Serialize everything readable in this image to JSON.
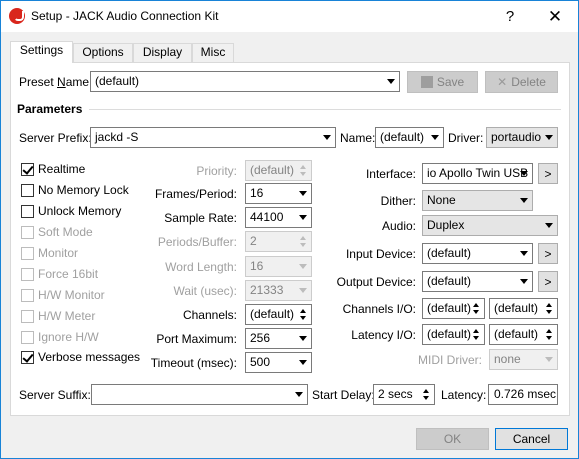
{
  "window": {
    "title": "Setup - JACK Audio Connection Kit",
    "help_glyph": "?",
    "close_glyph": "✕"
  },
  "tabs": [
    {
      "label": "Settings",
      "active": true
    },
    {
      "label": "Options",
      "active": false
    },
    {
      "label": "Display",
      "active": false
    },
    {
      "label": "Misc",
      "active": false
    }
  ],
  "preset": {
    "label_pre": "Preset ",
    "label_u": "N",
    "label_post": "ame:",
    "value": "(default)",
    "save": "Save",
    "delete": "Delete"
  },
  "parameters_title": "Parameters",
  "server_prefix": {
    "label": "Server Prefix:",
    "value": "jackd -S"
  },
  "name": {
    "label": "Name:",
    "value": "(default)"
  },
  "driver": {
    "label": "Driver:",
    "value": "portaudio"
  },
  "checkboxes": [
    {
      "label": "Realtime",
      "checked": true,
      "enabled": true
    },
    {
      "label": "No Memory Lock",
      "checked": false,
      "enabled": true
    },
    {
      "label": "Unlock Memory",
      "checked": false,
      "enabled": true
    },
    {
      "label": "Soft Mode",
      "checked": false,
      "enabled": false
    },
    {
      "label": "Monitor",
      "checked": false,
      "enabled": false
    },
    {
      "label": "Force 16bit",
      "checked": false,
      "enabled": false
    },
    {
      "label": "H/W Monitor",
      "checked": false,
      "enabled": false
    },
    {
      "label": "H/W Meter",
      "checked": false,
      "enabled": false
    },
    {
      "label": "Ignore H/W",
      "checked": false,
      "enabled": false
    },
    {
      "label": "Verbose messages",
      "checked": true,
      "enabled": true
    }
  ],
  "mid_fields": [
    {
      "label": "Priority:",
      "value": "(default)",
      "enabled": false
    },
    {
      "label": "Frames/Period:",
      "value": "16",
      "enabled": true
    },
    {
      "label": "Sample Rate:",
      "value": "44100",
      "enabled": true
    },
    {
      "label": "Periods/Buffer:",
      "value": "2",
      "enabled": false
    },
    {
      "label": "Word Length:",
      "value": "16",
      "enabled": false
    },
    {
      "label": "Wait (usec):",
      "value": "21333",
      "enabled": false
    },
    {
      "label": "Channels:",
      "value": "(default)",
      "enabled": true
    },
    {
      "label": "Port Maximum:",
      "value": "256",
      "enabled": true
    },
    {
      "label": "Timeout (msec):",
      "value": "500",
      "enabled": true
    }
  ],
  "right_fields": {
    "interface": {
      "label": "Interface:",
      "value": "io Apollo Twin USB",
      "btn": ">"
    },
    "dither": {
      "label": "Dither:",
      "value": "None"
    },
    "audio": {
      "label": "Audio:",
      "value": "Duplex"
    },
    "input_device": {
      "label": "Input Device:",
      "value": "(default)",
      "btn": ">"
    },
    "output_device": {
      "label": "Output Device:",
      "value": "(default)",
      "btn": ">"
    },
    "channels_io": {
      "label": "Channels I/O:",
      "in": "(default)",
      "out": "(default)"
    },
    "latency_io": {
      "label": "Latency I/O:",
      "in": "(default)",
      "out": "(default)"
    },
    "midi_driver": {
      "label": "MIDI Driver:",
      "value": "none"
    }
  },
  "bottom": {
    "suffix_label": "Server Suffix:",
    "suffix_value": "",
    "start_delay_label": "Start Delay:",
    "start_delay_value": "2 secs",
    "latency_label": "Latency:",
    "latency_value": "0.726 msec"
  },
  "footer": {
    "ok": "OK",
    "cancel": "Cancel"
  }
}
